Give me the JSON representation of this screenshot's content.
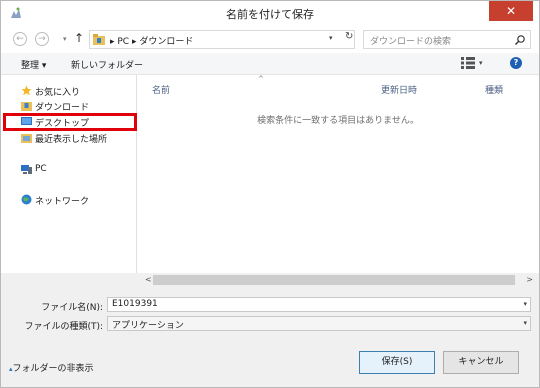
{
  "window": {
    "title": "名前を付けて保存",
    "close_symbol": "✕"
  },
  "address": {
    "back_symbol": "←",
    "forward_symbol": "→",
    "up_symbol": "↑",
    "path": "▸ PC ▸ ダウンロード",
    "refresh_symbol": "↻",
    "search_placeholder": "ダウンロードの検索"
  },
  "toolbar": {
    "organize_label": "整理 ▾",
    "new_folder_label": "新しいフォルダー"
  },
  "nav": {
    "favorites": "お気に入り",
    "downloads": "ダウンロード",
    "desktop": "デスクトップ",
    "recent": "最近表示した場所",
    "pc": "PC",
    "network": "ネットワーク"
  },
  "filelist": {
    "col_name": "名前",
    "col_modified": "更新日時",
    "col_type": "種類",
    "empty_message": "検索条件に一致する項目はありません。"
  },
  "form": {
    "filename_label": "ファイル名(N):",
    "filename_value": "E1019391",
    "filetype_label": "ファイルの種類(T):",
    "filetype_value": "アプリケーション"
  },
  "footer": {
    "hide_folders_label": "フォルダーの非表示",
    "save_label": "保存(S)",
    "cancel_label": "キャンセル"
  },
  "colors": {
    "close_red": "#c7402f",
    "highlight_red": "#e0000a",
    "header_text": "#4d6185",
    "primary_border": "#3c7fb1"
  }
}
